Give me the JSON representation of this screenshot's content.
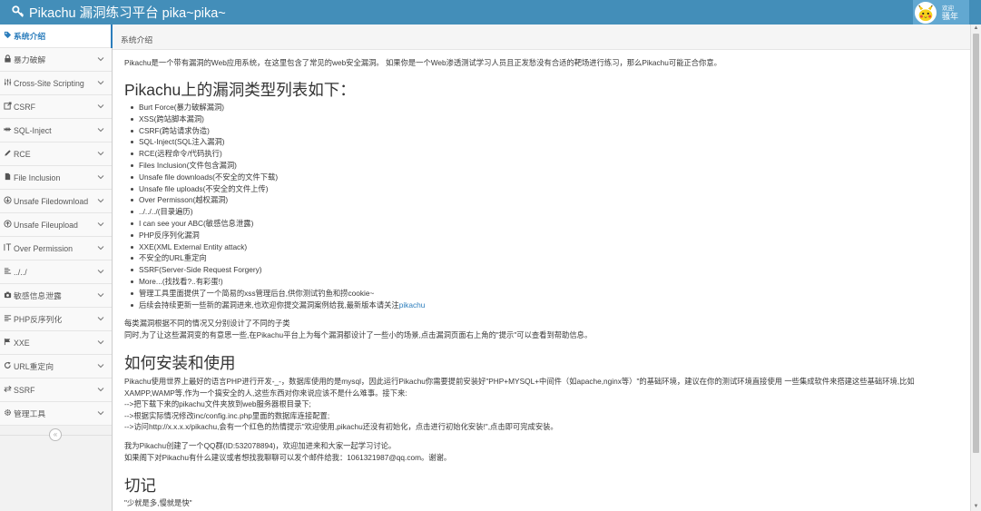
{
  "header": {
    "title": "Pikachu 漏洞练习平台 pika~pika~",
    "welcome": "欢迎",
    "user": "骚年"
  },
  "sidebar": {
    "items": [
      {
        "label": "系统介绍",
        "icon": "tag-icon",
        "active": true
      },
      {
        "label": "暴力破解",
        "icon": "lock-icon"
      },
      {
        "label": "Cross-Site Scripting",
        "icon": "sliders-icon"
      },
      {
        "label": "CSRF",
        "icon": "share-icon"
      },
      {
        "label": "SQL-Inject",
        "icon": "syringe-icon"
      },
      {
        "label": "RCE",
        "icon": "pencil-icon"
      },
      {
        "label": "File Inclusion",
        "icon": "file-icon"
      },
      {
        "label": "Unsafe Filedownload",
        "icon": "download-icon"
      },
      {
        "label": "Unsafe Fileupload",
        "icon": "upload-icon"
      },
      {
        "label": "Over Permission",
        "icon": "text-cursor-icon"
      },
      {
        "label": "../../",
        "icon": "list-icon"
      },
      {
        "label": "敏感信息泄露",
        "icon": "camera-icon"
      },
      {
        "label": "PHP反序列化",
        "icon": "align-icon"
      },
      {
        "label": "XXE",
        "icon": "flag-icon"
      },
      {
        "label": "URL重定向",
        "icon": "redo-icon"
      },
      {
        "label": "SSRF",
        "icon": "exchange-icon"
      },
      {
        "label": "管理工具",
        "icon": "gear-icon"
      }
    ],
    "collapse_icon": "double-chevron-left-icon"
  },
  "breadcrumb": "系统介绍",
  "main": {
    "intro": "Pikachu是一个带有漏洞的Web应用系统，在这里包含了常见的web安全漏洞。 如果你是一个Web渗透测试学习人员且正发愁没有合适的靶场进行练习，那么Pikachu可能正合你意。",
    "list_title": "Pikachu上的漏洞类型列表如下：",
    "vulns": [
      "Burt Force(暴力破解漏洞)",
      "XSS(跨站脚本漏洞)",
      "CSRF(跨站请求伪造)",
      "SQL-Inject(SQL注入漏洞)",
      "RCE(远程命令/代码执行)",
      "Files Inclusion(文件包含漏洞)",
      "Unsafe file downloads(不安全的文件下载)",
      "Unsafe file uploads(不安全的文件上传)",
      "Over Permisson(越权漏洞)",
      "../../../(目录遍历)",
      "I can see your ABC(敏感信息泄露)",
      "PHP反序列化漏洞",
      "XXE(XML External Entity attack)",
      "不安全的URL重定向",
      "SSRF(Server-Side Request Forgery)",
      "More...(找找看?..有彩蛋!)",
      "管理工具里面提供了一个简易的xss管理后台,供你测试钓鱼和捞cookie~"
    ],
    "last_item_text": "后续会持续更新一些新的漏洞进来,也欢迎你提交漏洞案例给我,最新版本请关注",
    "last_item_link": "pikachu",
    "desc1": "每类漏洞根据不同的情况又分别设计了不同的子类",
    "desc2": "同时,为了让这些漏洞变的有意思一些,在Pikachu平台上为每个漏洞都设计了一些小的场景,点击漏洞页面右上角的\"提示\"可以查看到帮助信息。",
    "install_title": "如何安装和使用",
    "install1": "Pikachu使用世界上最好的语言PHP进行开发-_-，数据库使用的是mysql，因此运行Pikachu你需要提前安装好\"PHP+MYSQL+中间件（如apache,nginx等）\"的基础环境，建议在你的测试环境直接使用 一些集成软件来搭建这些基础环境,比如",
    "install2": "XAMPP,WAMP等,作为一个搞安全的人,这些东西对你来说应该不是什么难事。接下来:",
    "step1": "-->把下载下来的pikachu文件夹放到web服务器根目录下;",
    "step2": "-->根据实际情况修改inc/config.inc.php里面的数据库连接配置;",
    "step3": "-->访问http://x.x.x.x/pikachu,会有一个红色的热情提示\"欢迎使用,pikachu还没有初始化，点击进行初始化安装!\",点击即可完成安装。",
    "qq": "我为Pikachu创建了一个QQ群(ID:532078894)，欢迎加进来和大家一起学习讨论。",
    "mail": "如果阁下对Pikachu有什么建议或者想找我聊聊可以发个邮件给我：1061321987@qq.com。谢谢。",
    "warn_title": "切记",
    "quote": "\"少就是多,慢就是快\""
  }
}
